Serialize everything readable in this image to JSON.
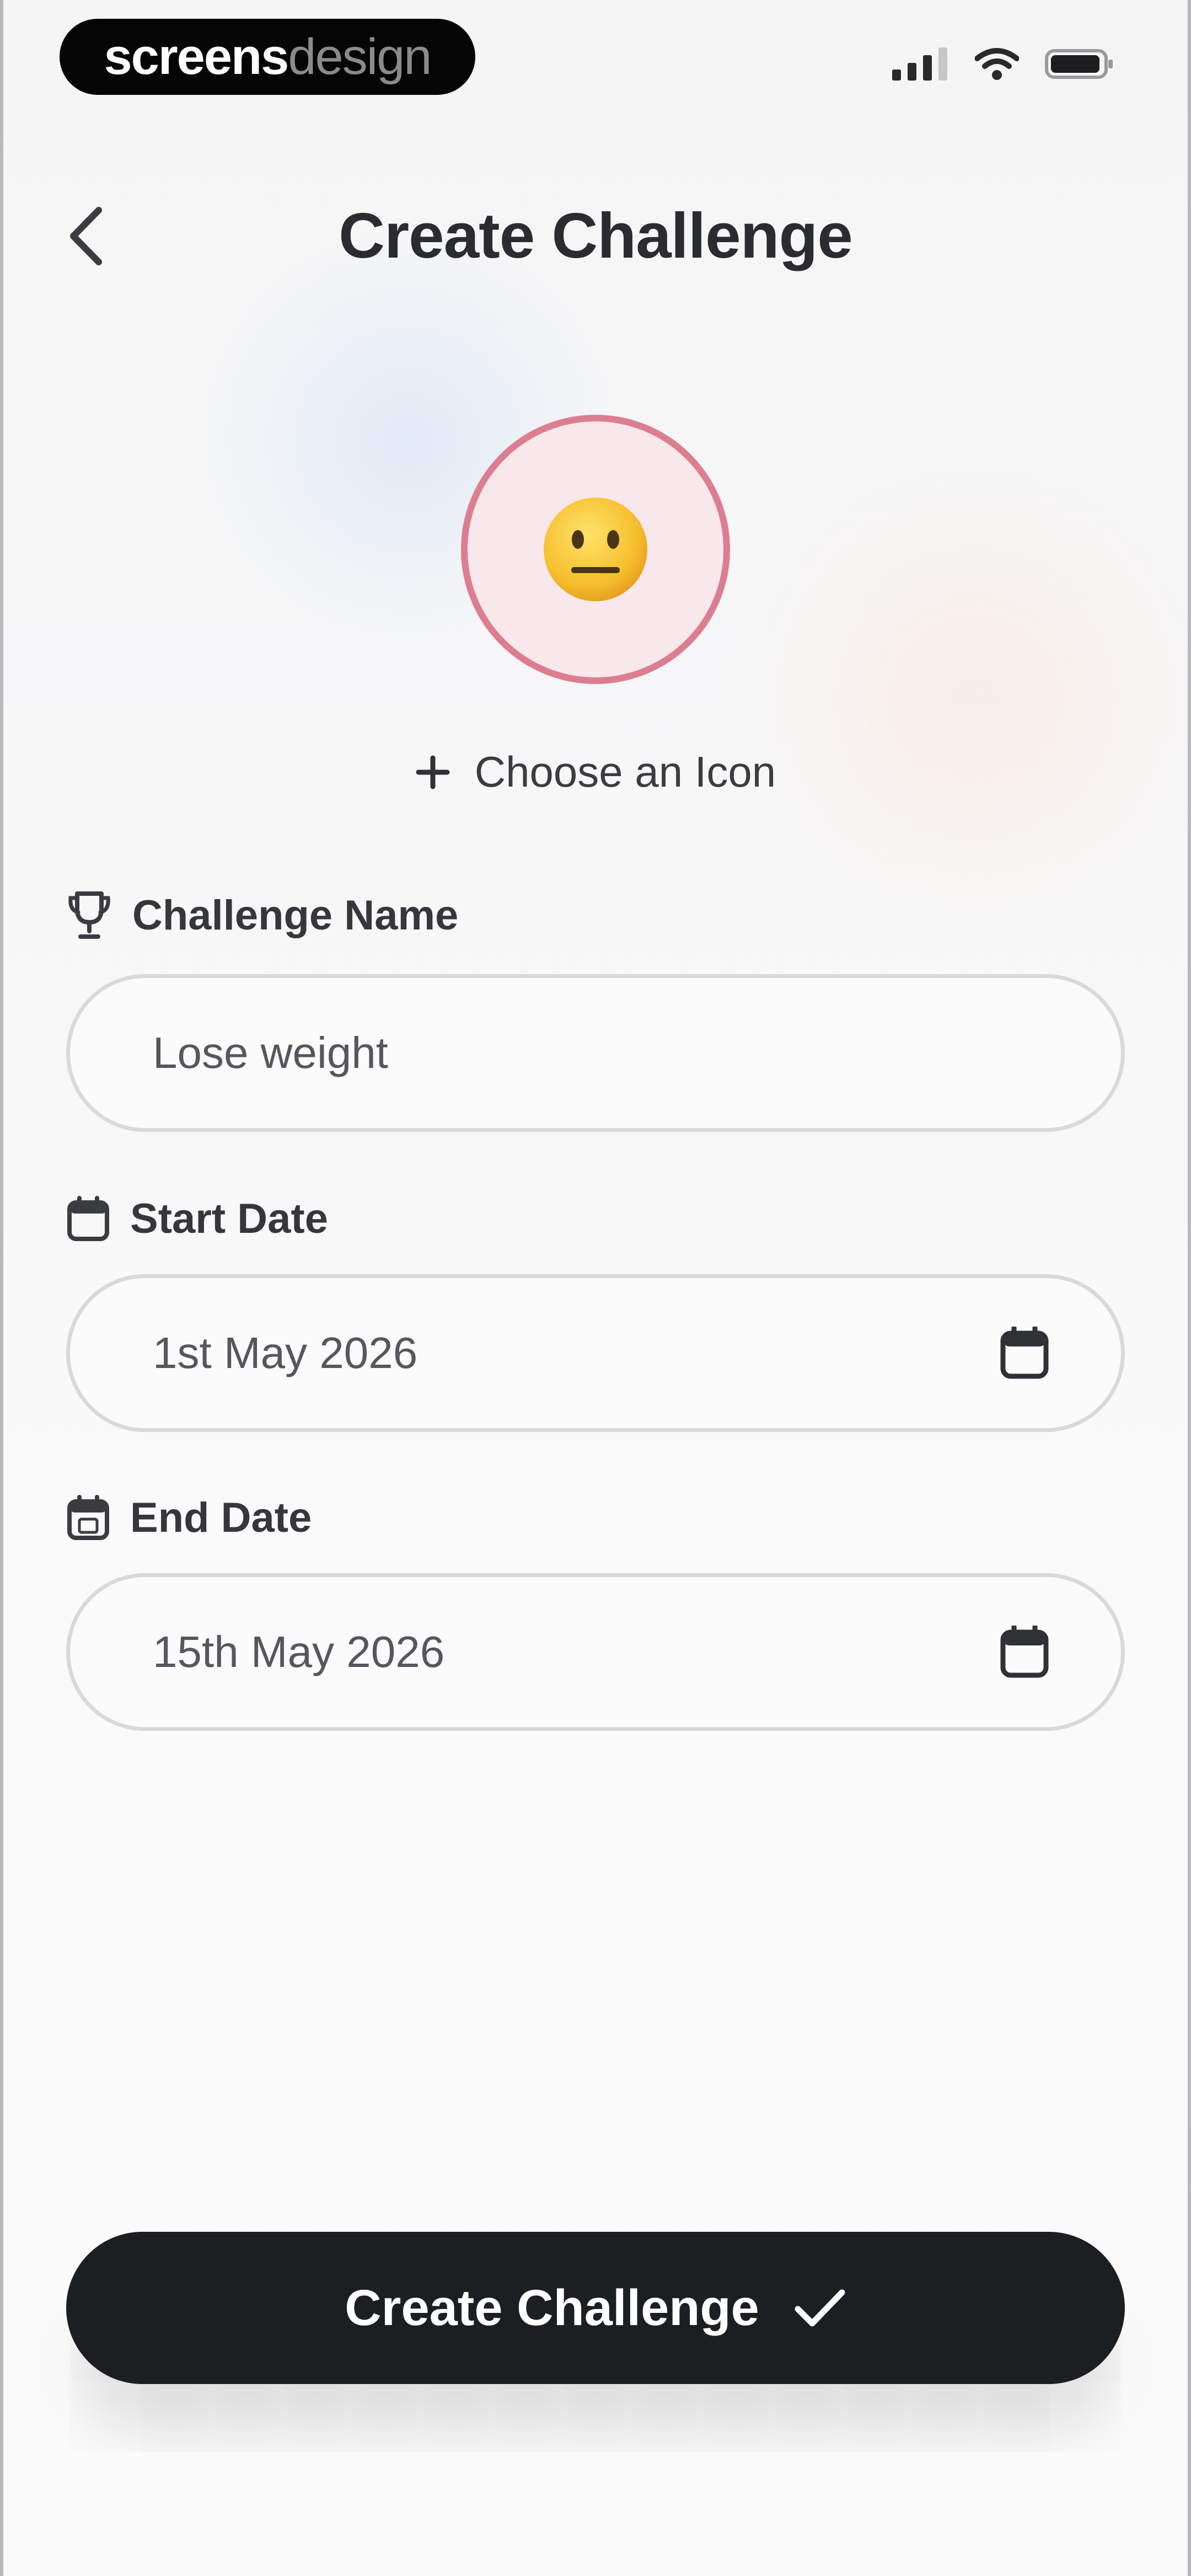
{
  "status_bar": {
    "brand_strong": "screens",
    "brand_light": "design"
  },
  "header": {
    "title": "Create Challenge"
  },
  "icon_picker": {
    "selected_icon": "neutral-face-emoji",
    "choose_label": "Choose an Icon",
    "ring_color": "#dc7e8f"
  },
  "form": {
    "name": {
      "label": "Challenge Name",
      "value": "Lose weight"
    },
    "start_date": {
      "label": "Start Date",
      "value": "1st May 2026"
    },
    "end_date": {
      "label": "End Date",
      "value": "15th May 2026"
    }
  },
  "cta": {
    "label": "Create Challenge",
    "background": "#1c1f22"
  },
  "icons": {
    "back": "chevron-left-icon",
    "add": "plus-icon",
    "name": "trophy-icon",
    "start": "calendar-icon",
    "end": "calendar-date-icon",
    "picker": "calendar-icon",
    "confirm": "checkmark-icon"
  }
}
